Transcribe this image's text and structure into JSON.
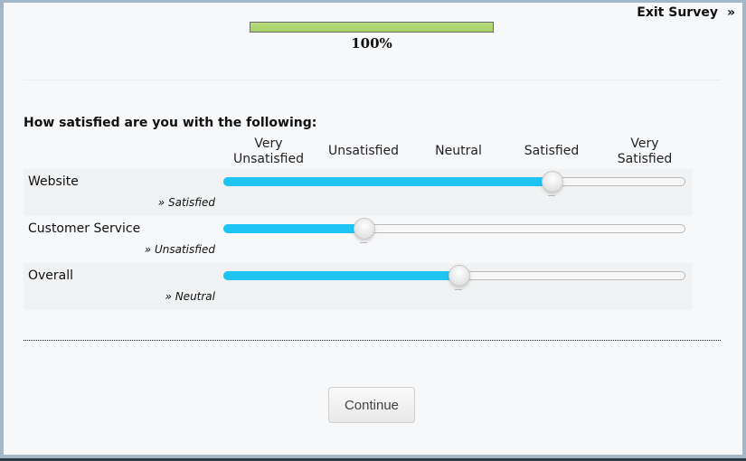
{
  "progress": {
    "percent": 100,
    "label": "100%",
    "fill_color": "#a4d166"
  },
  "header": {
    "exit_label": "Exit Survey",
    "exit_icon": "double-chevron-right-icon",
    "exit_glyph": "»"
  },
  "question": {
    "title": "How satisfied are you with the following:"
  },
  "scale": {
    "labels": [
      "Very\nUnsatisfied",
      "Unsatisfied",
      "Neutral",
      "Satisfied",
      "Very\nSatisfied"
    ],
    "min": 1,
    "max": 5
  },
  "rows": [
    {
      "label": "Website",
      "value": 4,
      "value_label": "» Satisfied"
    },
    {
      "label": "Customer Service",
      "value": 2,
      "value_label": "» Unsatisfied"
    },
    {
      "label": "Overall",
      "value": 3,
      "value_label": "» Neutral"
    }
  ],
  "footer": {
    "continue_label": "Continue"
  },
  "colors": {
    "slider_fill": "#1ec4f3",
    "window_border": "#a2b8c8"
  }
}
